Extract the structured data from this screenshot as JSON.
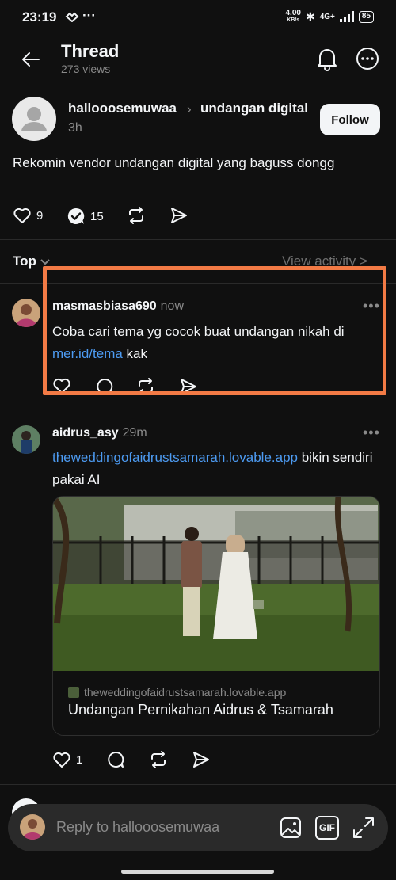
{
  "status_bar": {
    "time": "23:19",
    "net_speed_top": "4.00",
    "net_speed_unit": "KB/s",
    "network": "4G+",
    "battery": "85"
  },
  "header": {
    "title": "Thread",
    "views": "273 views"
  },
  "post": {
    "username": "hallooosemuwaa",
    "topic": "undangan digital",
    "time": "3h",
    "follow_label": "Follow",
    "text": "Rekomin vendor undangan digital yang baguss dongg",
    "likes": "9",
    "replies": "15"
  },
  "sort": {
    "label": "Top",
    "view_activity": "View activity >"
  },
  "replies": [
    {
      "username": "masmasbiasa690",
      "time": "now",
      "text_before": "Coba cari tema yg cocok buat undangan nikah di",
      "link": "mer.id/tema",
      "text_after": " kak"
    },
    {
      "username": "aidrus_asy",
      "time": "29m",
      "link": "theweddingofaidrustsamarah.lovable.app",
      "text_after": " bikin sendiri pakai AI",
      "card_domain": "theweddingofaidrustsamarah.lovable.app",
      "card_title": "Undangan Pernikahan Aidrus & Tsamarah",
      "likes": "1"
    }
  ],
  "composer": {
    "placeholder": "Reply to hallooosemuwaa",
    "gif_label": "GIF"
  },
  "colors": {
    "background": "#101010",
    "link": "#4d9bf2",
    "highlight": "#f27a45",
    "muted": "#8a8a8a"
  }
}
